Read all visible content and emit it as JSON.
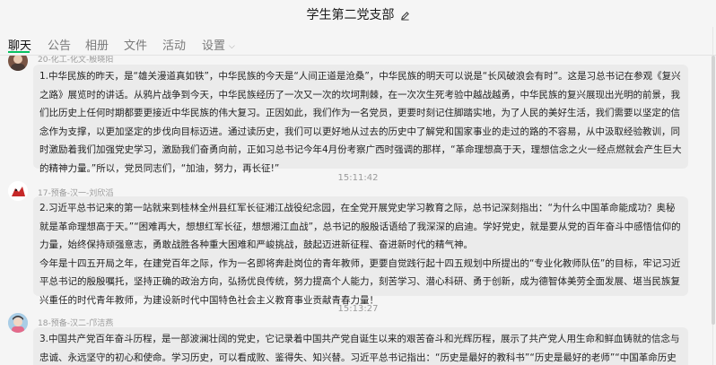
{
  "window": {
    "title": "学生第二党支部"
  },
  "tabs": [
    {
      "label": "聊天",
      "active": true
    },
    {
      "label": "公告"
    },
    {
      "label": "相册"
    },
    {
      "label": "文件"
    },
    {
      "label": "活动"
    },
    {
      "label": "设置"
    }
  ],
  "messages": [
    {
      "sender": "20-化工-化文-殷晓阳",
      "text": "1.中华民族的昨天，是“雄关漫道真如铁”，中华民族的今天是“人间正道是沧桑”，中华民族的明天可以说是“长风破浪会有时”。这是习总书记在参观《复兴之路》展览时的讲话。从鸦片战争到今天，中华民族经历了一次又一次的坎坷荆棘，在一次次生死考验中越战越勇，中华民族的复兴展现出光明的前景，我们比历史上任何时期都要更接近中华民族的伟大复习。正因如此，我们作为一名党员，更要时刻记住脚踏实地，为了人民的美好生活，我们需要以坚定的信念作为支撑，以更加坚定的步伐向目标迈进。通过读历史，我们可以更好地从过去的历史中了解党和国家事业的走过的路的不容易，从中汲取经验教训，同时激励着我们加强党史学习，激励我们奋勇向前，正如习总书记今年4月份考察广西时强调的那样，“革命理想高于天，理想信念之火一经点燃就会产生巨大的精神力量。”所以，党员同志们，“加油，努力，再长征!”"
    },
    {
      "time": "15:11:42",
      "sender": "17-预备-汉一-刘欣滔",
      "text": "2.习近平总书记来的第一站就来到桂林全州县红军长征湘江战役纪念园，在全党开展党史学习教育之际，总书记深刻指出：“为什么中国革命能成功？奥秘就是革命理想高于天。”“困难再大，想想红军长征，想想湘江血战”，总书记的殷殷话语给了我深深的启迪。学好党史，就是要从党的百年奋斗中感悟信仰的力量，始终保持顽强意志，勇敢战胜各种重大困难和严峻挑战，鼓起迈进新征程、奋进新时代的精气神。\n今年是十四五开局之年，在建党百年之际，作为一名即将奔赴岗位的青年教师，更要自觉践行起十四五规划中所提出的“专业化教师队伍”的目标，牢记习近平总书记的殷殷嘱托，坚持正确的政治方向，弘扬优良传统，努力提高个人能力，刻苦学习、潜心科研、勇于创新，成为德智体美劳全面发展、堪当民族复兴重任的时代青年教师，为建设新时代中国特色社会主义教育事业贡献青春力量！"
    },
    {
      "time": "15:13:27",
      "sender": "18-预备-汉二-邝洁燕",
      "text": "3.中国共产党百年奋斗历程，是一部波澜壮阔的党史，它记录着中国共产党自诞生以来的艰苦奋斗和光辉历程，展示了共产党人用生命和鲜血铸就的信念与忠诚、永远坚守的初心和使命。学习历史，可以看成败、鉴得失、知兴替。习近平总书记指出：“历史是最好的教科书”“历史是最好的老师”“中国革命历史是最好的营养"
    }
  ],
  "colors": {
    "accent": "#07c160",
    "bubble": "#ebebeb",
    "background": "#f5f5f5"
  },
  "icons": {
    "edit": "pencil-edit-icon",
    "settings_dropdown": "chevron-down-icon"
  }
}
